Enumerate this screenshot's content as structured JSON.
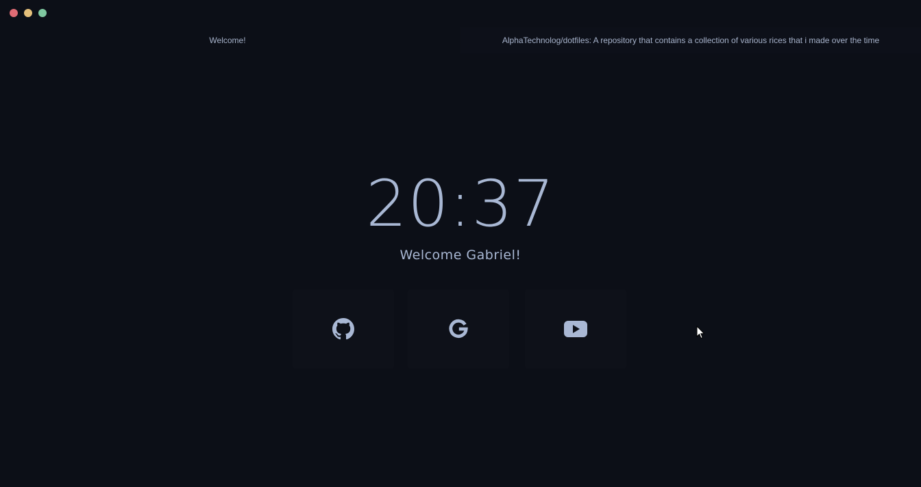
{
  "traffic_lights": {
    "close_color": "#e06c75",
    "minimize_color": "#e5c07b",
    "maximize_color": "#7fc8a0"
  },
  "tabs": [
    {
      "label": "Welcome!"
    },
    {
      "label": "AlphaTechnolog/dotfiles: A repository that contains a collection of various rices that i made over the time"
    }
  ],
  "clock": {
    "time": "20:37"
  },
  "greeting": {
    "text": "Welcome Gabriel!"
  },
  "links": [
    {
      "icon": "github-icon"
    },
    {
      "icon": "google-icon"
    },
    {
      "icon": "youtube-icon"
    }
  ],
  "colors": {
    "background": "#0c0f17",
    "card": "#0e1119",
    "foreground": "#a9b8d4"
  }
}
